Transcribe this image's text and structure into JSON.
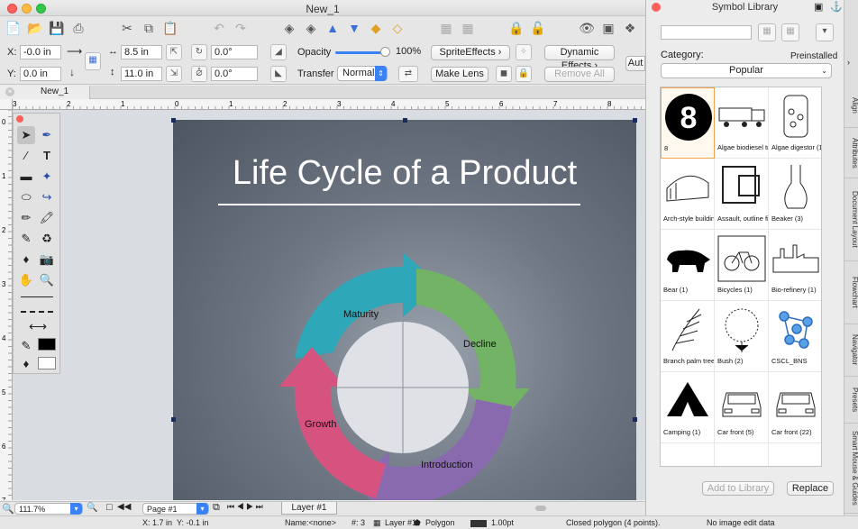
{
  "window": {
    "title": "New_1"
  },
  "toolbar": {
    "icons": [
      "new-icon",
      "open-icon",
      "save-icon",
      "print-icon",
      "cut-icon",
      "copy-icon",
      "paste-icon",
      "undo-icon",
      "redo-icon",
      "layers-icon",
      "align-icon",
      "arrange-icon",
      "grid-icon",
      "lock-icon",
      "preview-icon"
    ]
  },
  "controls": {
    "x_label": "X:",
    "x_value": "-0.0 in",
    "y_label": "Y:",
    "y_value": "0.0 in",
    "width_value": "8.5 in",
    "height_value": "11.0 in",
    "rotation_value": "0.0°",
    "skew_value": "0.0°",
    "opacity_label": "Opacity",
    "opacity_value": "100%",
    "opacity_level": 1.0,
    "transfer_label": "Transfer",
    "transfer_mode": "Normal",
    "sprite_effects": "SpriteEffects",
    "dynamic_effects": "Dynamic Effects",
    "make_lens": "Make Lens",
    "remove_all": "Remove All",
    "auto_label": "Aut"
  },
  "document": {
    "tab_name": "New_1",
    "ruler_top": [
      "3",
      "2",
      "1",
      "0",
      "1",
      "2",
      "3",
      "4",
      "5",
      "6",
      "7",
      "8"
    ],
    "ruler_left": [
      "0",
      "1",
      "2",
      "3",
      "4",
      "5",
      "6",
      "7"
    ]
  },
  "slide": {
    "title": "Life Cycle of a Product",
    "stages": [
      "Maturity",
      "Decline",
      "Introduction",
      "Growth"
    ],
    "colors": {
      "maturity": "#2ea7b8",
      "decline": "#72b365",
      "introduction": "#8a6aae",
      "growth": "#d6537f"
    }
  },
  "statusbar": {
    "zoom": "111.7%",
    "page": "Page #1",
    "layer": "Layer #1",
    "cursor_x": "X: 1.7 in",
    "cursor_y": "Y: -0.1 in",
    "name": "Name:<none>",
    "count": "#: 3",
    "layer_item": "Layer #1",
    "shape": "Polygon",
    "stroke": "1.00pt",
    "description": "Closed polygon (4 points).",
    "image_edit": "No image edit data"
  },
  "library": {
    "title": "Symbol Library",
    "category_label": "Category:",
    "preinstalled_label": "Preinstalled",
    "category_value": "Popular",
    "symbols": [
      {
        "label": "8",
        "icon": "number-8-icon"
      },
      {
        "label": "Algae biodiesel tra",
        "icon": "truck-icon"
      },
      {
        "label": "Algae digestor (1)",
        "icon": "digestor-icon"
      },
      {
        "label": "Arch-style building",
        "icon": "arch-building-icon"
      },
      {
        "label": "Assault, outline fis",
        "icon": "fist-icon"
      },
      {
        "label": "Beaker (3)",
        "icon": "beaker-icon"
      },
      {
        "label": "Bear (1)",
        "icon": "bear-icon"
      },
      {
        "label": "Bicycles (1)",
        "icon": "bicycle-icon"
      },
      {
        "label": "Bio-refinery (1)",
        "icon": "refinery-icon"
      },
      {
        "label": "Branch palm tree",
        "icon": "palm-branch-icon"
      },
      {
        "label": "Bush (2)",
        "icon": "bush-icon"
      },
      {
        "label": "CSCL_BNS",
        "icon": "molecule-icon"
      },
      {
        "label": "Camping (1)",
        "icon": "tent-icon"
      },
      {
        "label": "Car front (5)",
        "icon": "car-front-icon"
      },
      {
        "label": "Car front (22)",
        "icon": "car-front-icon"
      }
    ],
    "add_button": "Add to Library",
    "replace_button": "Replace"
  },
  "side_tabs": [
    "Align",
    "Attributes",
    "Document Layout",
    "Flowchart",
    "Navigator",
    "Presets",
    "Smart Mouse & Guides"
  ]
}
